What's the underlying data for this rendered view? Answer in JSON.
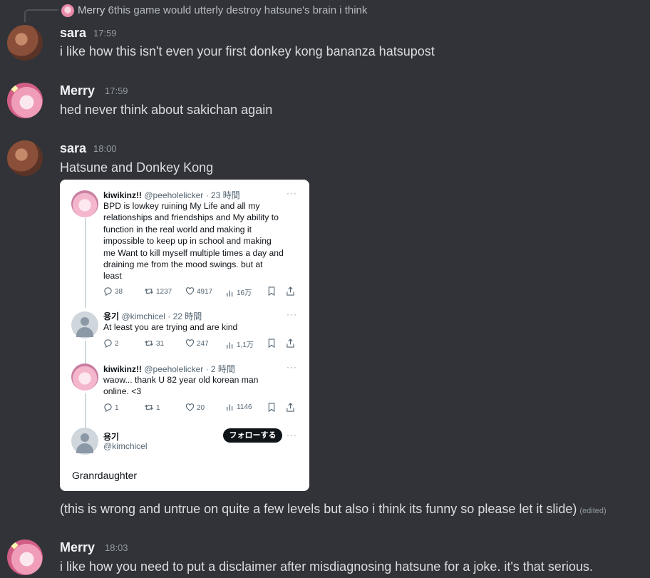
{
  "reply": {
    "author": "Merry",
    "text": "6this game would utterly destroy hatsune's brain i think"
  },
  "messages": [
    {
      "author": "sara",
      "time": "17:59",
      "text": "i like how this isn't even your first donkey kong bananza hatsupost"
    },
    {
      "author": "Merry",
      "time": "17:59",
      "text": "hed never think about sakichan again"
    },
    {
      "author": "sara",
      "time": "18:00",
      "text": "Hatsune and Donkey Kong",
      "followup": "(this is wrong and untrue on quite a few levels but also i think its funny so please let it slide)",
      "edited": "(edited)"
    },
    {
      "author": "Merry",
      "time": "18:03",
      "text": "i like how you need to put a disclaimer after misdiagnosing hatsune for a joke. it's that serious."
    }
  ],
  "embed": {
    "tweets": [
      {
        "display_name": "kiwikinz!!",
        "meta": "@peeholelicker · 23 時間",
        "lines": [
          "BPD is lowkey ruining My Life and all my",
          "relationships and friendships and My ability to",
          "function in the real world and making it",
          "impossible to keep up in school  and making",
          "me Want to kill myself multiple times a day and",
          "draining me from the mood swings. but at",
          "least"
        ],
        "replies": "38",
        "retweets": "1237",
        "likes": "4917",
        "views": "16万"
      },
      {
        "display_name": "용기",
        "meta": "@kimchicel · 22 時間",
        "lines": [
          "At least you are trying and are kind"
        ],
        "replies": "2",
        "retweets": "31",
        "likes": "247",
        "views": "1,1万"
      },
      {
        "display_name": "kiwikinz!!",
        "meta": "@peeholelicker · 2 時間",
        "lines": [
          "waow... thank U 82 year old korean man",
          "online. <3"
        ],
        "replies": "1",
        "retweets": "1",
        "likes": "20",
        "views": "1146"
      }
    ],
    "profile": {
      "display_name": "용기",
      "handle": "@kimchicel",
      "follow_label": "フォローする"
    },
    "caption": "Granrdaughter",
    "more": "···"
  }
}
